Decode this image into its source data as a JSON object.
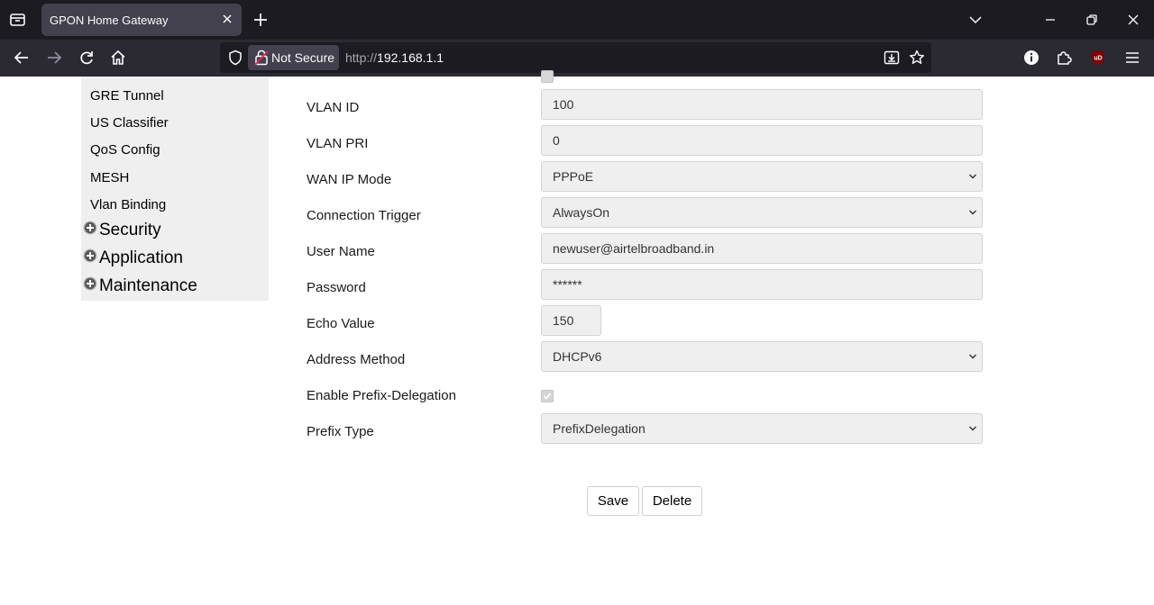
{
  "browser": {
    "tab_title": "GPON Home Gateway",
    "security_label": "Not Secure",
    "url_scheme": "http://",
    "url_host": "192.168.1.1"
  },
  "sidebar": {
    "sub_items": [
      "GRE Tunnel",
      "US Classifier",
      "QoS Config",
      "MESH",
      "Vlan Binding"
    ],
    "categories": [
      "Security",
      "Application",
      "Maintenance"
    ]
  },
  "form": {
    "vlan_id": {
      "label": "VLAN ID",
      "value": "100"
    },
    "vlan_pri": {
      "label": "VLAN PRI",
      "value": "0"
    },
    "wan_ip_mode": {
      "label": "WAN IP Mode",
      "value": "PPPoE"
    },
    "connection_trigger": {
      "label": "Connection Trigger",
      "value": "AlwaysOn"
    },
    "user_name": {
      "label": "User Name",
      "value": "newuser@airtelbroadband.in"
    },
    "password": {
      "label": "Password",
      "value": "******"
    },
    "echo_value": {
      "label": "Echo Value",
      "value": "150"
    },
    "address_method": {
      "label": "Address Method",
      "value": "DHCPv6"
    },
    "enable_prefix_delegation": {
      "label": "Enable Prefix-Delegation",
      "checked": true
    },
    "prefix_type": {
      "label": "Prefix Type",
      "value": "PrefixDelegation"
    }
  },
  "actions": {
    "save_label": "Save",
    "delete_label": "Delete"
  },
  "colors": {
    "tabbar_bg": "#1c1b22",
    "navbar_bg": "#2b2a33",
    "field_bg": "#efefef",
    "sidebar_bg": "#efefef"
  }
}
